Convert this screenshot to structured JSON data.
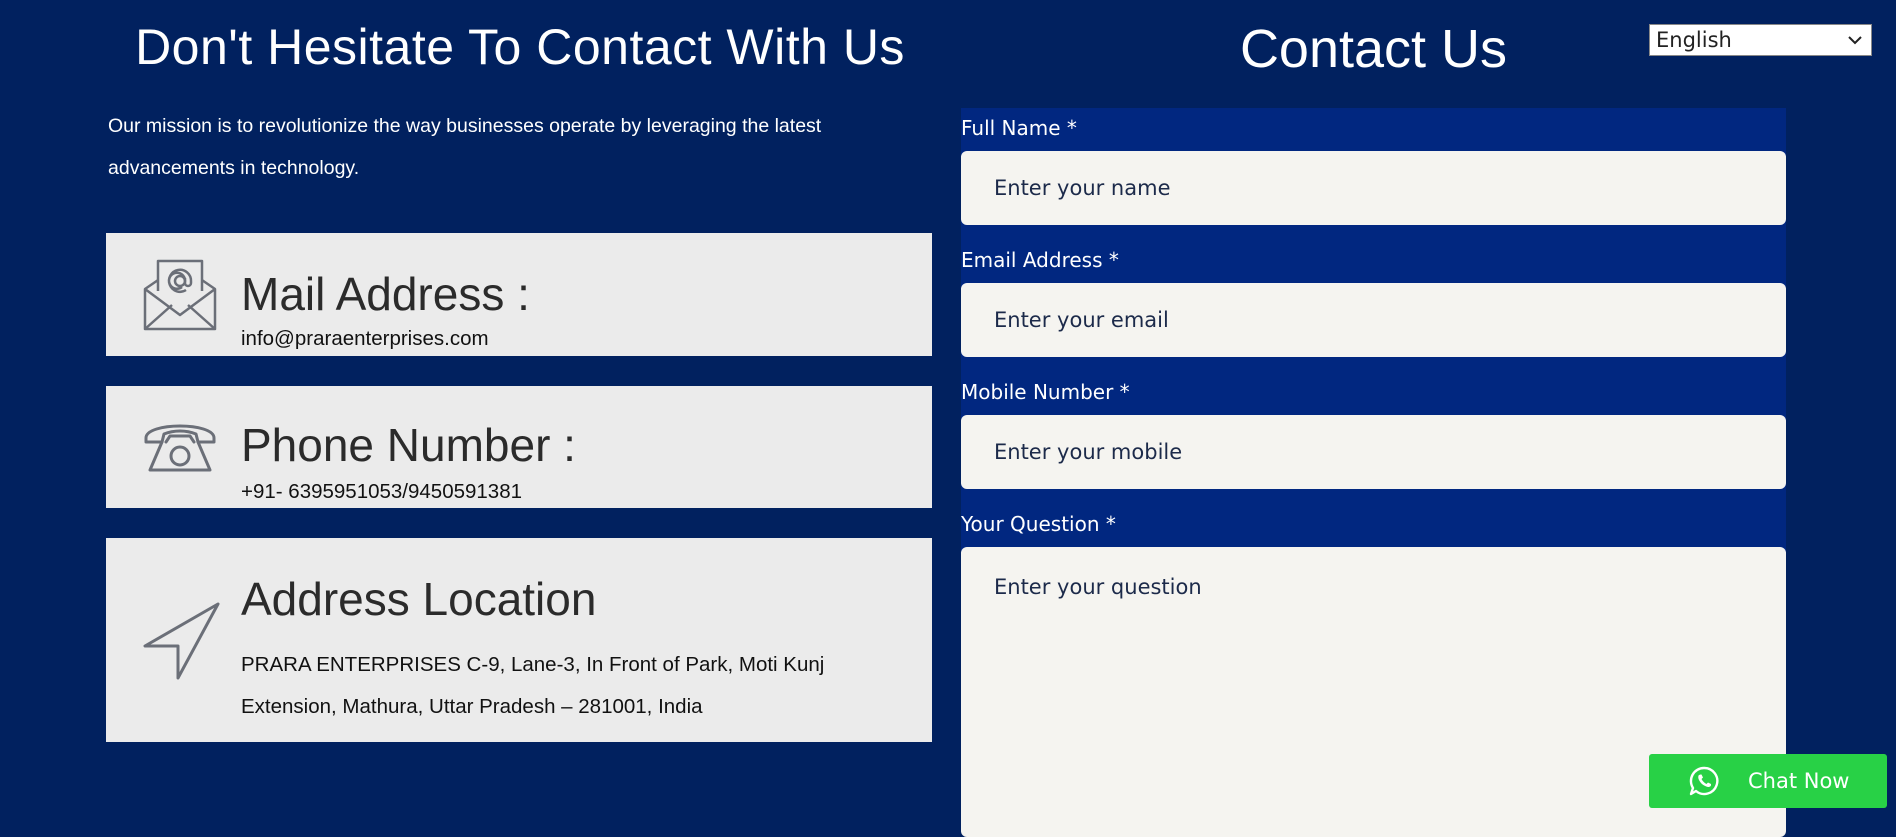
{
  "left": {
    "title": "Don't Hesitate To Contact With Us",
    "mission": "Our mission is to revolutionize the way businesses operate by leveraging the latest advancements in technology."
  },
  "cards": {
    "mail": {
      "heading": "Mail Address :",
      "value": "info@praraenterprises.com",
      "icon": "mail-icon"
    },
    "phone": {
      "heading": "Phone Number :",
      "value": "+91- 6395951053/9450591381",
      "icon": "phone-icon"
    },
    "address": {
      "heading": "Address Location",
      "value": "PRARA ENTERPRISES C-9, Lane-3, In Front of Park, Moti Kunj Extension, Mathura, Uttar Pradesh – 281001, India",
      "icon": "location-arrow-icon"
    }
  },
  "form": {
    "title": "Contact Us",
    "name": {
      "label": "Full Name *",
      "placeholder": "Enter your name"
    },
    "email": {
      "label": "Email Address *",
      "placeholder": "Enter your email"
    },
    "mobile": {
      "label": "Mobile Number *",
      "placeholder": "Enter your mobile"
    },
    "question": {
      "label": "Your Question *",
      "placeholder": "Enter your question"
    }
  },
  "language": {
    "selected": "English"
  },
  "chat": {
    "label": "Chat Now",
    "icon": "whatsapp-icon"
  },
  "colors": {
    "background": "#01215f",
    "form_panel": "#012780",
    "card": "#ebebeb",
    "chat_button": "#28d146"
  }
}
